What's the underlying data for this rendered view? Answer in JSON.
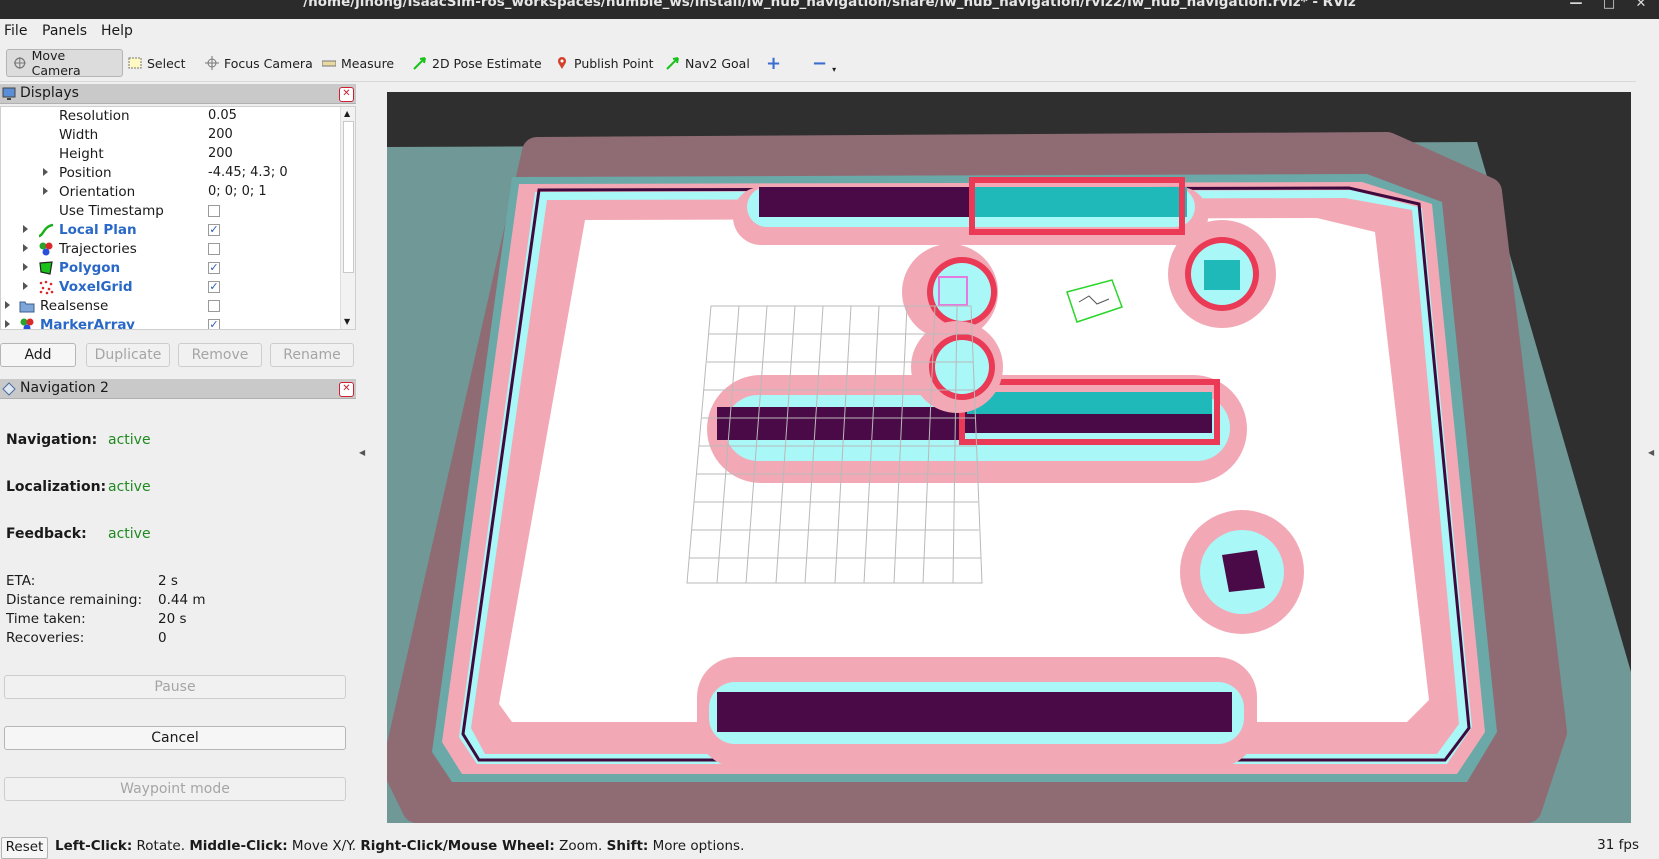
{
  "window": {
    "title": "/home/jihong/IsaacSim-ros_workspaces/humble_ws/install/iw_hub_navigation/share/iw_hub_navigation/rviz2/iw_hub_navigation.rviz* - RViz"
  },
  "menu": {
    "file": "File",
    "panels": "Panels",
    "help": "Help"
  },
  "toolbar": {
    "move_camera": "Move Camera",
    "select": "Select",
    "focus_camera": "Focus Camera",
    "measure": "Measure",
    "pose_estimate": "2D Pose Estimate",
    "publish_point": "Publish Point",
    "nav2_goal": "Nav2 Goal"
  },
  "displays": {
    "title": "Displays",
    "rows": [
      {
        "name": "Resolution",
        "value": "0.05"
      },
      {
        "name": "Width",
        "value": "200"
      },
      {
        "name": "Height",
        "value": "200"
      },
      {
        "name": "Position",
        "value": "-4.45; 4.3; 0"
      },
      {
        "name": "Orientation",
        "value": "0; 0; 0; 1"
      },
      {
        "name": "Use Timestamp",
        "value": ""
      },
      {
        "name": "Local Plan",
        "value": "✓"
      },
      {
        "name": "Trajectories",
        "value": ""
      },
      {
        "name": "Polygon",
        "value": "✓"
      },
      {
        "name": "VoxelGrid",
        "value": "✓"
      },
      {
        "name": "Realsense",
        "value": ""
      },
      {
        "name": "MarkerArray",
        "value": "✓"
      }
    ],
    "buttons": {
      "add": "Add",
      "duplicate": "Duplicate",
      "remove": "Remove",
      "rename": "Rename"
    }
  },
  "navigation": {
    "title": "Navigation 2",
    "navigation_label": "Navigation:",
    "navigation_value": "active",
    "localization_label": "Localization:",
    "localization_value": "active",
    "feedback_label": "Feedback:",
    "feedback_value": "active",
    "eta_label": "ETA:",
    "eta_value": "2 s",
    "distance_label": "Distance remaining:",
    "distance_value": "0.44 m",
    "time_label": "Time taken:",
    "time_value": "20 s",
    "recoveries_label": "Recoveries:",
    "recoveries_value": "0",
    "pause": "Pause",
    "cancel": "Cancel",
    "waypoint": "Waypoint mode"
  },
  "status": {
    "reset": "Reset",
    "k1": "Left-Click:",
    "v1": " Rotate. ",
    "k2": "Middle-Click:",
    "v2": " Move X/Y. ",
    "k3": "Right-Click/Mouse Wheel:",
    "v3": " Zoom. ",
    "k4": "Shift:",
    "v4": " More options.",
    "fps": "31 fps"
  },
  "colors": {
    "costmap_outer": "#8f6c74",
    "costmap_pink": "#f1a8b4",
    "costmap_cyan": "#a9f7f7",
    "obstacle": "#4a0a47",
    "ground": "#6f9897",
    "active_green": "#1f8a1f"
  }
}
